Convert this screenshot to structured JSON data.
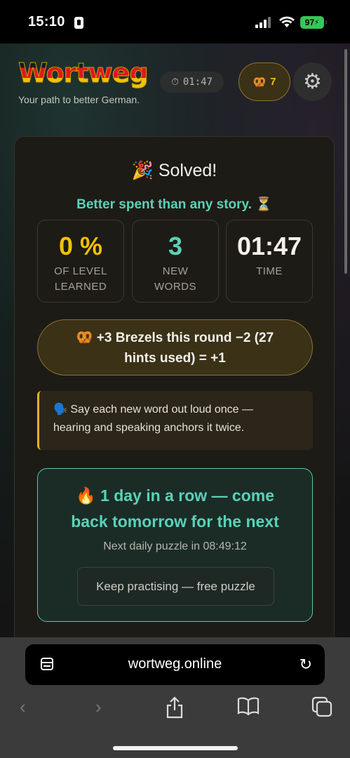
{
  "status_bar": {
    "time": "15:10",
    "battery": "97"
  },
  "header": {
    "logo": "Wortweg",
    "tagline": "Your path to better German.",
    "timer": "01:47",
    "brezels_count": "7"
  },
  "result": {
    "title": "🎉 Solved!",
    "subtitle": "Better spent than any story. ⏳",
    "stats": [
      {
        "value": "0 %",
        "label_line1": "OF LEVEL",
        "label_line2": "LEARNED",
        "color": "#f2c200"
      },
      {
        "value": "3",
        "label_line1": "NEW",
        "label_line2": "WORDS",
        "color": "#5ad2b8"
      },
      {
        "value": "01:47",
        "label_line1": "TIME",
        "label_line2": "",
        "color": "#f3f1ea"
      }
    ],
    "brezel_line1": "🥨 +3 Brezels this round −2 (27",
    "brezel_line2": "hints used) = +1",
    "tip_line1": "🗣️ Say each new word out loud once —",
    "tip_line2": "hearing and speaking anchors it twice.",
    "streak_line1": "🔥 1 day in a row — come",
    "streak_line2": "back tomorrow for the next",
    "next_puzzle": "Next daily puzzle in 08:49:12",
    "practice_button": "Keep practising — free puzzle"
  },
  "browser": {
    "url": "wortweg.online"
  },
  "colors": {
    "accent_teal": "#5ad2b8",
    "accent_gold": "#f2c200"
  }
}
